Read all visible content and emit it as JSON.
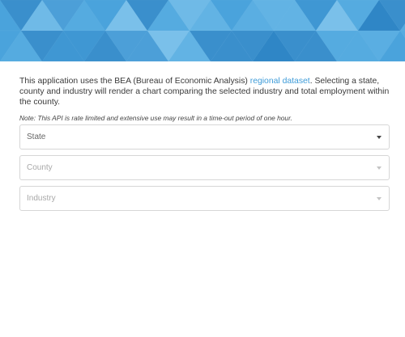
{
  "intro": {
    "text_before_link": "This application uses the BEA (Bureau of Economic Analysis) ",
    "link_text": "regional dataset",
    "text_after_link": ". Selecting a state, county and industry will render a chart comparing the selected industry and total employment within the county."
  },
  "note": "Note: This API is rate limited and extensive use may result in a time-out period of one hour.",
  "selects": {
    "state": {
      "placeholder": "State",
      "enabled": true
    },
    "county": {
      "placeholder": "County",
      "enabled": false
    },
    "industry": {
      "placeholder": "Industry",
      "enabled": false
    }
  },
  "colors": {
    "banner_primary": "#4aa3dc",
    "link": "#3d9bd8"
  },
  "icons": {
    "dropdown": "chevron-down-icon"
  }
}
